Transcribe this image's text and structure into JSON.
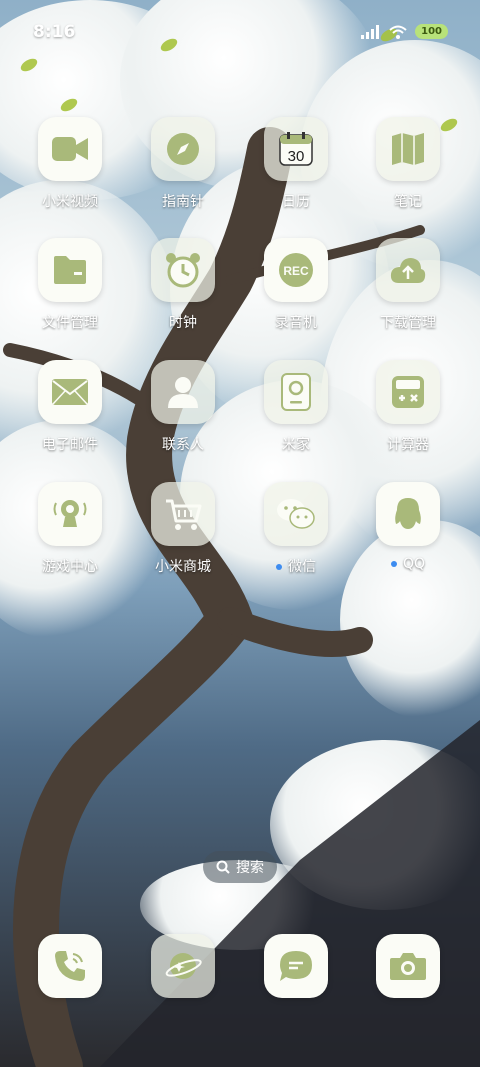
{
  "status_bar": {
    "time": "8:16",
    "battery": "100"
  },
  "apps": [
    {
      "label": "小米视频",
      "icon": "video-icon"
    },
    {
      "label": "指南针",
      "icon": "compass-icon"
    },
    {
      "label": "日历",
      "icon": "calendar-icon",
      "badge_text": "30"
    },
    {
      "label": "笔记",
      "icon": "notes-icon"
    },
    {
      "label": "文件管理",
      "icon": "folder-icon"
    },
    {
      "label": "时钟",
      "icon": "clock-icon"
    },
    {
      "label": "录音机",
      "icon": "recorder-icon",
      "badge_text": "REC"
    },
    {
      "label": "下载管理",
      "icon": "download-cloud-icon"
    },
    {
      "label": "电子邮件",
      "icon": "mail-icon"
    },
    {
      "label": "联系人",
      "icon": "contacts-icon"
    },
    {
      "label": "米家",
      "icon": "mijia-icon"
    },
    {
      "label": "计算器",
      "icon": "calculator-icon"
    },
    {
      "label": "游戏中心",
      "icon": "game-center-icon"
    },
    {
      "label": "小米商城",
      "icon": "shopping-cart-icon"
    },
    {
      "label": "微信",
      "icon": "wechat-icon",
      "new_dot": true
    },
    {
      "label": "QQ",
      "icon": "qq-penguin-icon",
      "new_dot": true
    }
  ],
  "search": {
    "label": "搜索"
  },
  "dock": [
    {
      "icon": "phone-icon"
    },
    {
      "icon": "browser-icon"
    },
    {
      "icon": "messages-icon"
    },
    {
      "icon": "camera-icon"
    }
  ],
  "colors": {
    "accent": "#a9b97a",
    "icon_glyph": "#9fb06a",
    "tile": "#fbfcf6",
    "dot": "#3d8cf0"
  }
}
